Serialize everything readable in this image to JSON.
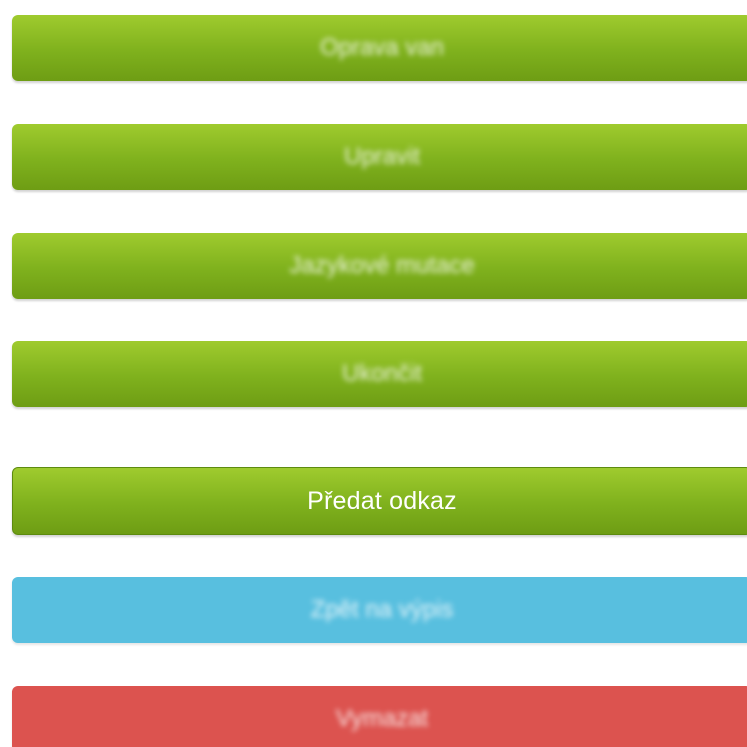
{
  "buttons": {
    "b1": "Oprava van",
    "b2": "Upravit",
    "b3": "Jazykové mutace",
    "b4": "Ukončit",
    "b5": "Předat odkaz",
    "b6": "Zpět na výpis",
    "b7": "Vymazat"
  },
  "colors": {
    "green": "#85b521",
    "blue": "#58bfdf",
    "red": "#dc534f"
  }
}
